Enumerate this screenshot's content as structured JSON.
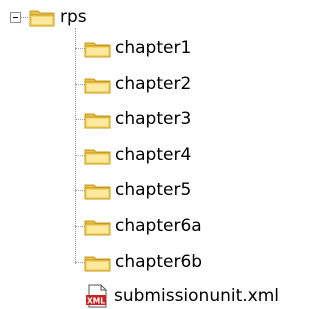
{
  "tree": {
    "root": {
      "label": "rps",
      "icon": "folder-open-icon",
      "expanded": true
    },
    "children": [
      {
        "label": "chapter1",
        "icon": "folder-icon"
      },
      {
        "label": "chapter2",
        "icon": "folder-icon"
      },
      {
        "label": "chapter3",
        "icon": "folder-icon"
      },
      {
        "label": "chapter4",
        "icon": "folder-icon"
      },
      {
        "label": "chapter5",
        "icon": "folder-icon"
      },
      {
        "label": "chapter6a",
        "icon": "folder-icon"
      },
      {
        "label": "chapter6b",
        "icon": "folder-icon"
      }
    ],
    "file": {
      "label": "submissionunit.xml",
      "icon": "xml-file-icon",
      "badge": "XML"
    }
  },
  "colors": {
    "folder_fill": "#f5d66b",
    "folder_fill_light": "#fde9a0",
    "folder_stroke": "#c79a1a",
    "xml_red": "#cc2222",
    "connector": "#a0a0a0"
  }
}
